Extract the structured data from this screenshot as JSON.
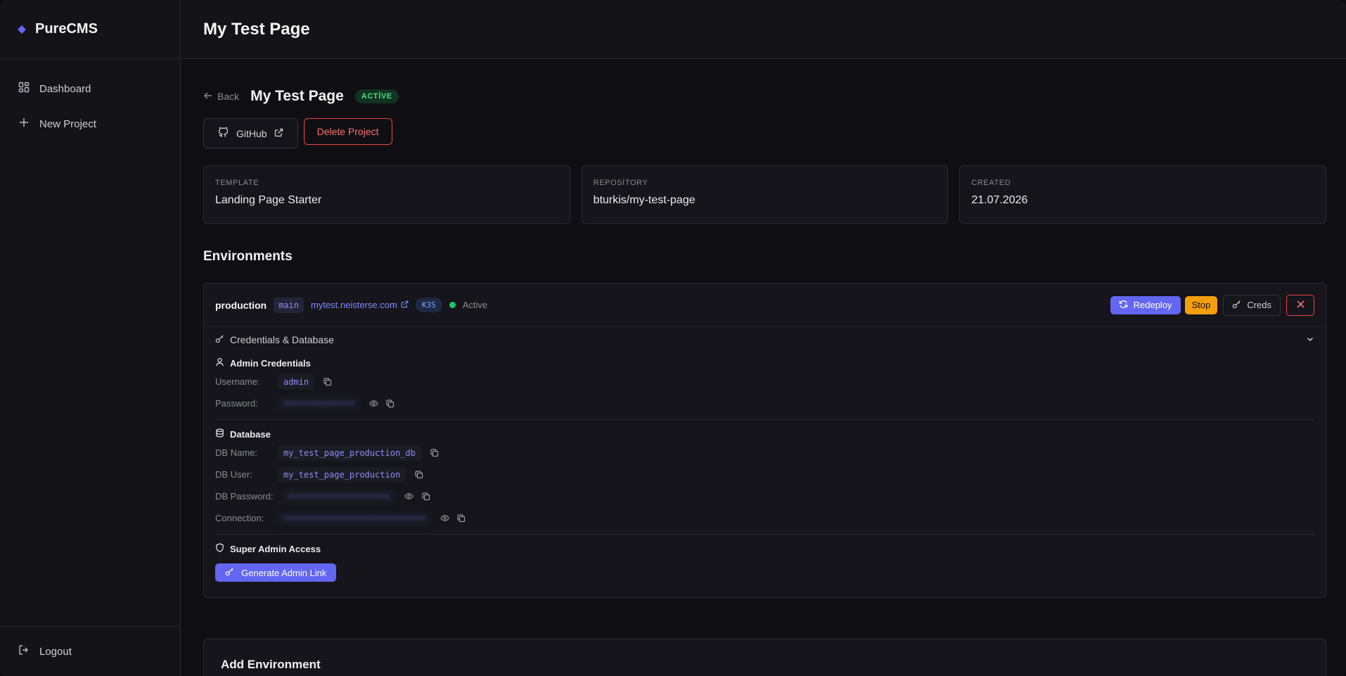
{
  "sidebar": {
    "brand": "PureCMS",
    "items": [
      {
        "label": "Dashboard",
        "icon": "dashboard-grid-icon"
      },
      {
        "label": "New Project",
        "icon": "plus-icon"
      }
    ],
    "logout": "Logout"
  },
  "header": {
    "title": "My Test Page"
  },
  "project": {
    "back": "Back",
    "title": "My Test Page",
    "status": "ACTİVE",
    "github": "GitHub",
    "delete": "Delete Project"
  },
  "info": [
    {
      "label": "TEMPLATE",
      "value": "Landing Page Starter"
    },
    {
      "label": "REPOSİTORY",
      "value": "bturkis/my-test-page"
    },
    {
      "label": "CREATED",
      "value": "21.07.2026"
    }
  ],
  "environments": {
    "title": "Environments",
    "items": [
      {
        "name": "production",
        "branch": "main",
        "domain": "mytest.neisterse.com",
        "runtime": "K3S",
        "status": "Active",
        "actions": {
          "redeploy": "Redeploy",
          "stop": "Stop",
          "creds": "Creds"
        },
        "collapse_label": "Credentials & Database",
        "admin": {
          "title": "Admin Credentials",
          "username_label": "Username:",
          "username": "admin",
          "password_label": "Password:",
          "password": "••••••••••••••"
        },
        "database": {
          "title": "Database",
          "name_label": "DB Name:",
          "name": "my_test_page_production_db",
          "user_label": "DB User:",
          "user": "my_test_page_production",
          "password_label": "DB Password:",
          "password": "••••••••••••••••••••",
          "connection_label": "Connection:",
          "connection": "••••••••••••••••••••••••••••"
        },
        "super_admin": {
          "title": "Super Admin Access",
          "button": "Generate Admin Link"
        }
      }
    ]
  },
  "add_environment": {
    "title": "Add Environment"
  },
  "colors": {
    "accent": "#6366f1",
    "danger": "#ef4444",
    "success": "#22c55e",
    "warning": "#f59e0b"
  }
}
